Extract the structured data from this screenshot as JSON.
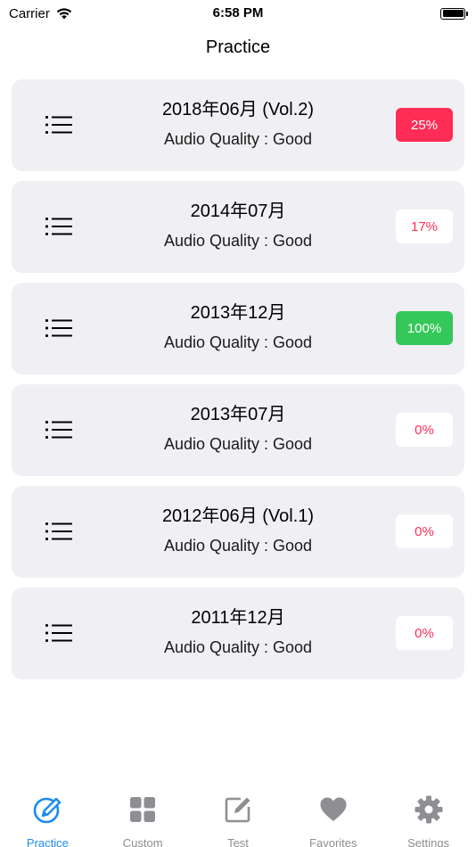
{
  "status_bar": {
    "carrier": "Carrier",
    "time": "6:58 PM"
  },
  "nav": {
    "title": "Practice"
  },
  "colors": {
    "accent": "#1a8cf0",
    "badge_red": "#ff2d55",
    "badge_green": "#34c759",
    "badge_text_red": "#ff2d55",
    "tab_inactive": "#8e8e93"
  },
  "items": [
    {
      "title": "2018年06月 (Vol.2)",
      "subtitle": "Audio Quality : Good",
      "progress": "25%",
      "style": "filled-red"
    },
    {
      "title": "2014年07月",
      "subtitle": "Audio Quality : Good",
      "progress": "17%",
      "style": "outline-red"
    },
    {
      "title": "2013年12月",
      "subtitle": "Audio Quality : Good",
      "progress": "100%",
      "style": "filled-green"
    },
    {
      "title": "2013年07月",
      "subtitle": "Audio Quality : Good",
      "progress": "0%",
      "style": "outline-red"
    },
    {
      "title": "2012年06月 (Vol.1)",
      "subtitle": "Audio Quality : Good",
      "progress": "0%",
      "style": "outline-red"
    },
    {
      "title": "2011年12月",
      "subtitle": "Audio Quality : Good",
      "progress": "0%",
      "style": "outline-red"
    }
  ],
  "tabs": [
    {
      "label": "Practice",
      "icon": "pencil-circle-icon",
      "active": true
    },
    {
      "label": "Custom",
      "icon": "grid-icon",
      "active": false
    },
    {
      "label": "Test",
      "icon": "edit-square-icon",
      "active": false
    },
    {
      "label": "Favorites",
      "icon": "heart-icon",
      "active": false
    },
    {
      "label": "Settings",
      "icon": "gear-icon",
      "active": false
    }
  ]
}
